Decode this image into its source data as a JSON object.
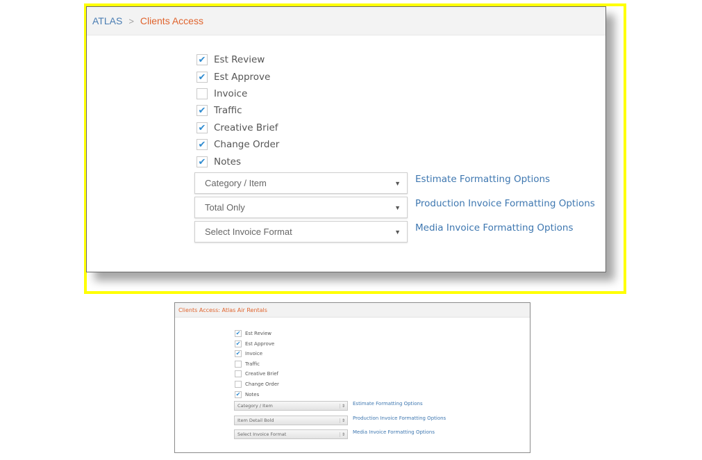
{
  "top_panel": {
    "breadcrumb": {
      "root": "ATLAS",
      "separator": ">",
      "current": "Clients Access"
    },
    "checkboxes": [
      {
        "label": "Est Review",
        "checked": true,
        "mark": "✔"
      },
      {
        "label": "Est Approve",
        "checked": true,
        "mark": "✔"
      },
      {
        "label": "Invoice",
        "checked": false,
        "mark": ""
      },
      {
        "label": "Traffic",
        "checked": true,
        "mark": "✔"
      },
      {
        "label": "Creative Brief",
        "checked": true,
        "mark": "✔"
      },
      {
        "label": "Change Order",
        "checked": true,
        "mark": "✔"
      },
      {
        "label": "Notes",
        "checked": true,
        "mark": "✔"
      }
    ],
    "selects": [
      {
        "value": "Category / Item",
        "link": "Estimate Formatting Options"
      },
      {
        "value": "Total Only",
        "link": "Production Invoice Formatting Options"
      },
      {
        "value": "Select Invoice Format",
        "link": "Media Invoice Formatting Options"
      }
    ],
    "select_arrow": "▼"
  },
  "bottom_panel": {
    "title": "Clients Access: Atlas Air Rentals",
    "checkboxes": [
      {
        "label": "Est Review",
        "checked": true,
        "mark": "✔"
      },
      {
        "label": "Est Approve",
        "checked": true,
        "mark": "✔"
      },
      {
        "label": "Invoice",
        "checked": true,
        "mark": "✔"
      },
      {
        "label": "Traffic",
        "checked": false,
        "mark": ""
      },
      {
        "label": "Creative Brief",
        "checked": false,
        "mark": ""
      },
      {
        "label": "Change Order",
        "checked": false,
        "mark": ""
      },
      {
        "label": "Notes",
        "checked": true,
        "mark": "✔"
      }
    ],
    "selects": [
      {
        "value": "Category / Item",
        "link": "Estimate Formatting Options"
      },
      {
        "value": "Item Detail Bold",
        "link": "Production Invoice Formatting Options"
      },
      {
        "value": "Select Invoice Format",
        "link": "Media Invoice Formatting Options"
      }
    ],
    "select_arrow": "⇕"
  },
  "colors": {
    "highlight": "#ffff00",
    "accent": "#e0642e",
    "link": "#3e77b0",
    "check": "#2f8bd0"
  }
}
